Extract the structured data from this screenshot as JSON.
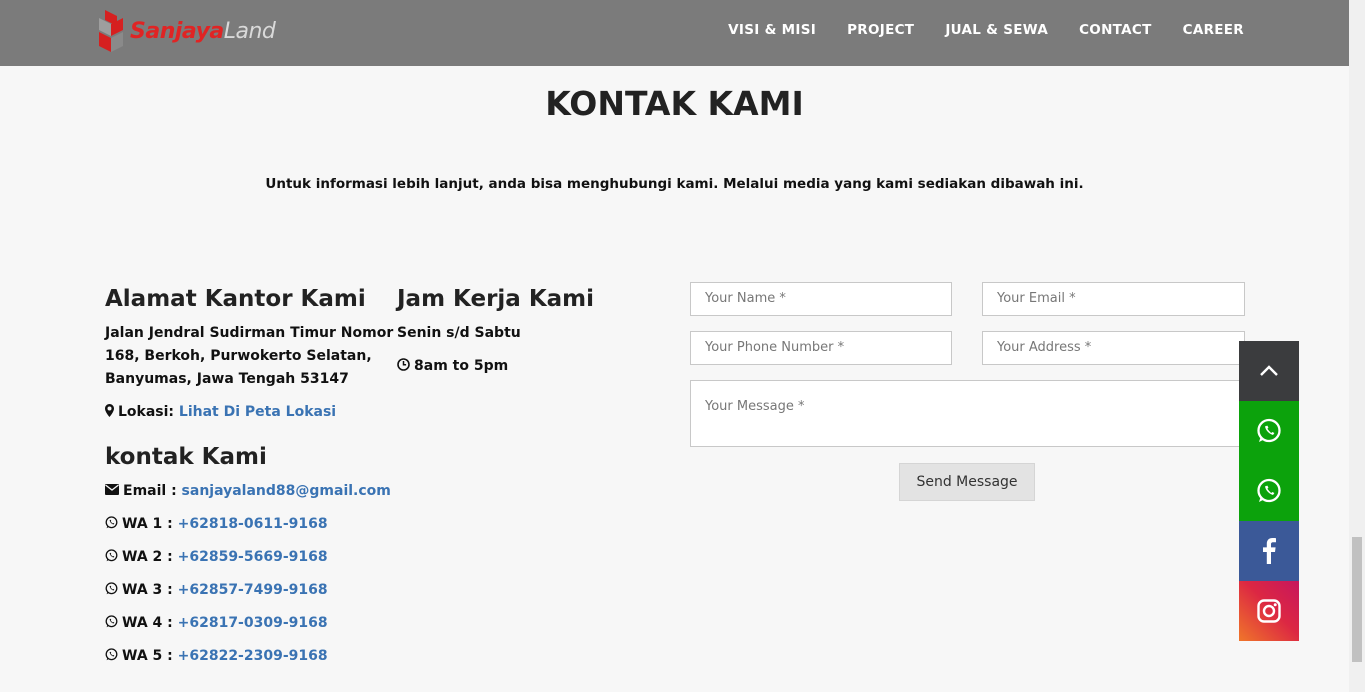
{
  "brand": {
    "part1": "Sanjaya",
    "part2": "Land"
  },
  "nav": {
    "items": [
      "VISI & MISI",
      "PROJECT",
      "JUAL & SEWA",
      "CONTACT",
      "CAREER"
    ]
  },
  "page": {
    "title": "KONTAK KAMI",
    "subtitle": "Untuk informasi lebih lanjut, anda bisa menghubungi kami. Melalui media yang kami sediakan dibawah ini."
  },
  "office": {
    "heading": "Alamat Kantor Kami",
    "address_lines": [
      "Jalan Jendral Sudirman Timur Nomor",
      "168, Berkoh, Purwokerto Selatan,",
      "Banyumas, Jawa Tengah 53147"
    ],
    "location_label": "Lokasi: ",
    "location_link": "Lihat Di Peta Lokasi"
  },
  "hours": {
    "heading": "Jam Kerja Kami",
    "days": "Senin s/d Sabtu",
    "time": "8am to 5pm"
  },
  "contact": {
    "heading": "kontak Kami",
    "email_label": "Email : ",
    "email": "sanjayaland88@gmail.com",
    "wa": [
      {
        "label": "WA 1 : ",
        "number": "+62818-0611-9168"
      },
      {
        "label": "WA 2 : ",
        "number": "+62859-5669-9168"
      },
      {
        "label": "WA 3 : ",
        "number": "+62857-7499-9168"
      },
      {
        "label": "WA 4 : ",
        "number": "+62817-0309-9168"
      },
      {
        "label": "WA 5 : ",
        "number": "+62822-2309-9168"
      }
    ]
  },
  "form": {
    "name_placeholder": "Your Name *",
    "email_placeholder": "Your Email *",
    "phone_placeholder": "Your Phone Number  *",
    "address_placeholder": "Your Address *",
    "message_placeholder": "Your Message *",
    "send_label": "Send Message"
  },
  "floating": {
    "icons": [
      "chevron-up-icon",
      "whatsapp-icon",
      "whatsapp-icon",
      "facebook-icon",
      "instagram-icon"
    ],
    "colors": {
      "top": "#3b3c3e",
      "whatsapp": "#0ca20c",
      "facebook": "#3b5998",
      "instagram_from": "#f0762a",
      "instagram_to": "#c7165d"
    }
  }
}
